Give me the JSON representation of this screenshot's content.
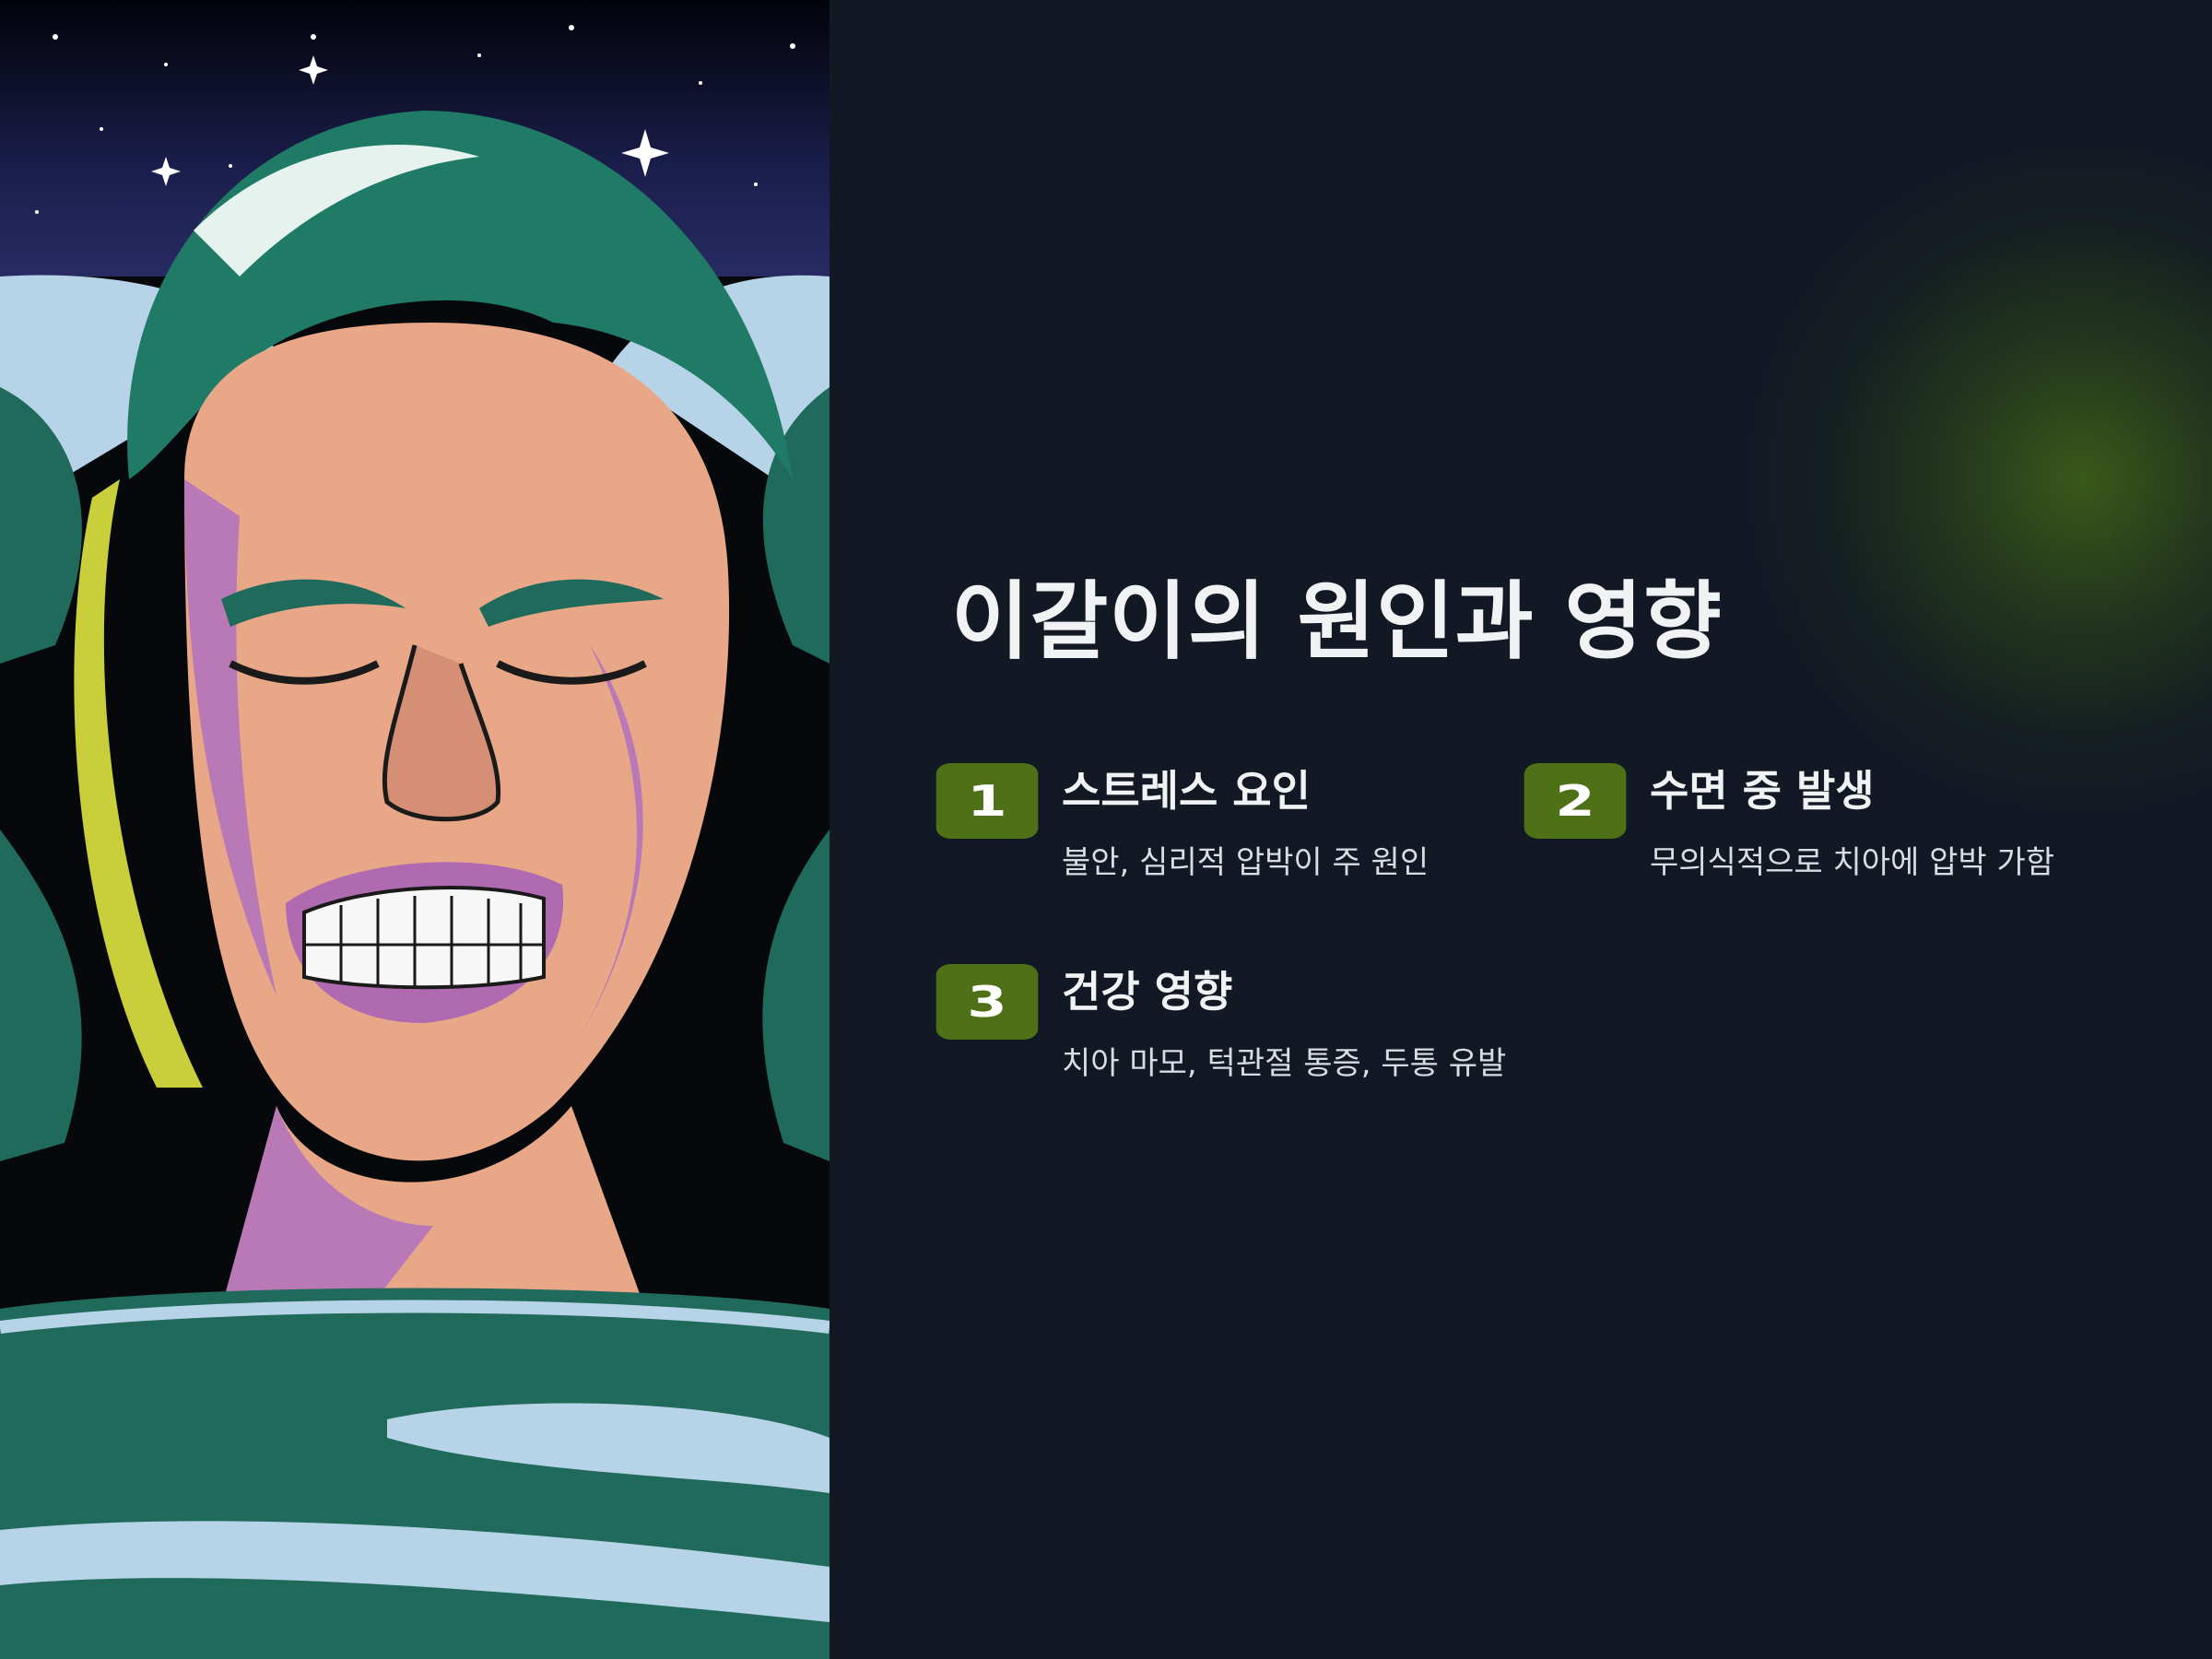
{
  "slide": {
    "title": "이갈이의 원인과 영향",
    "accent_color": "#4e7016",
    "background_color": "#121824",
    "glow_color": "#3c5c18",
    "items": [
      {
        "number": "1",
        "title": "스트레스 요인",
        "description": "불안, 심리적 압박이 주 원인"
      },
      {
        "number": "2",
        "title": "수면 중 발생",
        "description": "무의식적으로 치아에 압박 가함"
      },
      {
        "number": "3",
        "title": "건강 영향",
        "description": "치아 마모, 턱관절 통증, 두통 유발"
      }
    ]
  },
  "illustration": {
    "subject": "grinding-teeth-sleeper-illustration",
    "icon": "sleeping-man-clenching-teeth"
  }
}
